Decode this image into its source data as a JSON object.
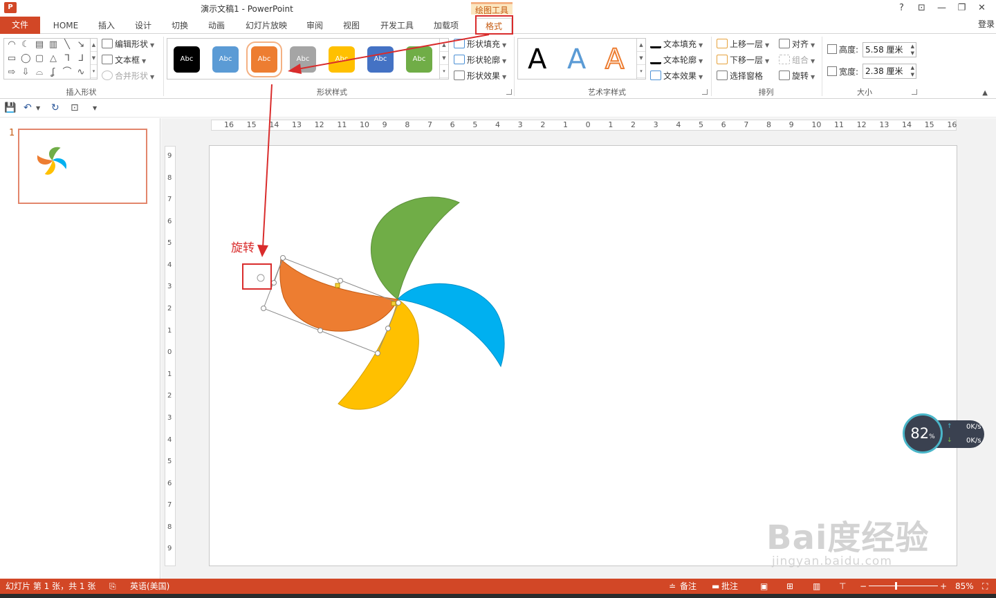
{
  "window": {
    "title": "演示文稿1 - PowerPoint",
    "context_label": "绘图工具",
    "help": "?",
    "ribbon_display": "⊡",
    "minimize": "—",
    "restore": "❐",
    "close": "✕",
    "login": "登录"
  },
  "tabs": {
    "file": "文件",
    "home": "HOME",
    "insert": "插入",
    "design": "设计",
    "transitions": "切换",
    "animations": "动画",
    "slideshow": "幻灯片放映",
    "review": "审阅",
    "view": "视图",
    "developer": "开发工具",
    "addins": "加载项",
    "format": "格式"
  },
  "ribbon": {
    "insert_shapes": {
      "label": "插入形状",
      "edit_shape": "编辑形状",
      "text_box": "文本框",
      "merge_shapes": "合并形状"
    },
    "shape_styles": {
      "label": "形状样式",
      "swatch_text": "Abc",
      "swatches": [
        "#000000",
        "#5b9bd5",
        "#ed7d31",
        "#a5a5a5",
        "#ffc000",
        "#4472c4",
        "#70ad47"
      ],
      "shape_fill": "形状填充",
      "shape_outline": "形状轮廓",
      "shape_effects": "形状效果"
    },
    "wordart_styles": {
      "label": "艺术字样式",
      "sample": "A",
      "text_fill": "文本填充",
      "text_outline": "文本轮廓",
      "text_effects": "文本效果"
    },
    "arrange": {
      "label": "排列",
      "bring_forward": "上移一层",
      "send_backward": "下移一层",
      "selection_pane": "选择窗格",
      "align": "对齐",
      "group": "组合",
      "rotate": "旋转"
    },
    "size": {
      "label": "大小",
      "height_label": "高度:",
      "height_value": "5.58 厘米",
      "width_label": "宽度:",
      "width_value": "2.38 厘米"
    }
  },
  "thumbnails": {
    "slide_number": "1"
  },
  "rulers": {
    "horizontal": [
      "16",
      "15",
      "14",
      "13",
      "12",
      "11",
      "10",
      "9",
      "8",
      "7",
      "6",
      "5",
      "4",
      "3",
      "2",
      "1",
      "0",
      "1",
      "2",
      "3",
      "4",
      "5",
      "6",
      "7",
      "8",
      "9",
      "10",
      "11",
      "12",
      "13",
      "14",
      "15",
      "16"
    ],
    "vertical": [
      "9",
      "8",
      "7",
      "6",
      "5",
      "4",
      "3",
      "2",
      "1",
      "0",
      "1",
      "2",
      "3",
      "4",
      "5",
      "6",
      "7",
      "8",
      "9"
    ]
  },
  "annotation": {
    "rotate_label": "旋转",
    "colors": {
      "annotation": "#d92c2c"
    }
  },
  "pinwheel": {
    "colors": {
      "green": "#70ad47",
      "blue": "#00b0f0",
      "orange": "#ed7d31",
      "yellow": "#ffc000"
    }
  },
  "net_widget": {
    "percent": "82",
    "percent_sign": "%",
    "upload": "0K/s",
    "download": "0K/s"
  },
  "watermark": {
    "main": "Bai度经验",
    "sub": "jingyan.baidu.com"
  },
  "status": {
    "slide_info": "幻灯片 第 1 张，共 1 张",
    "language": "英语(美国)",
    "notes": "备注",
    "comments": "批注",
    "zoom": "85%"
  },
  "theme": {
    "accent": "#d24726",
    "tab_active": "#c55a11"
  }
}
